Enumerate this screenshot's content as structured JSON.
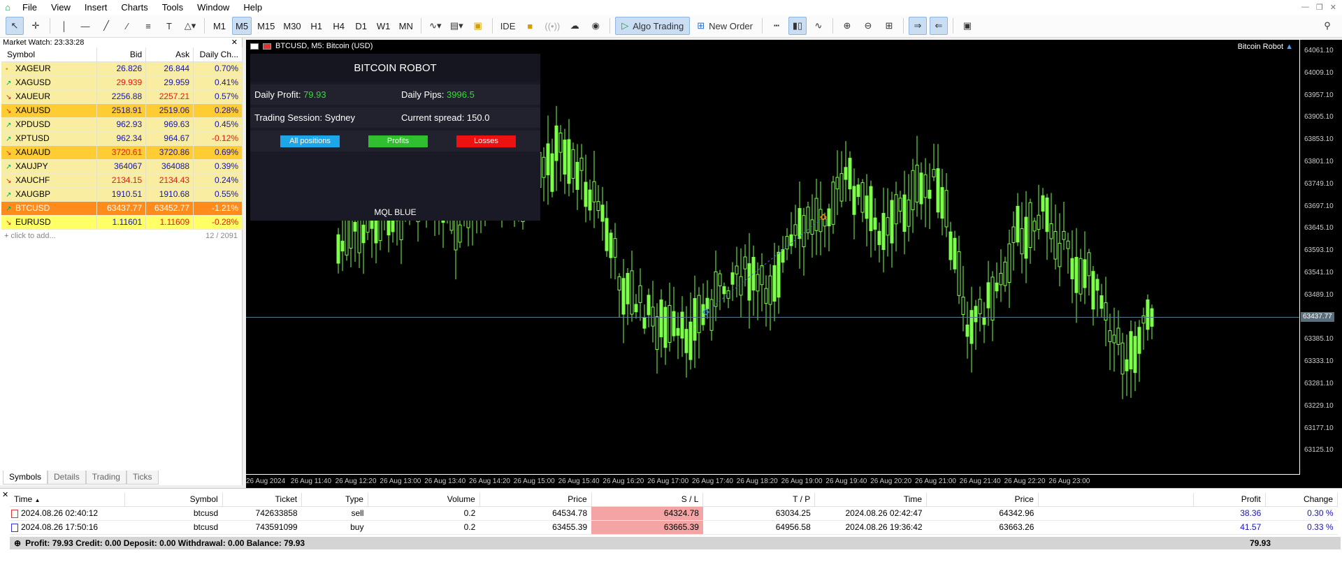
{
  "menu": {
    "items": [
      "File",
      "View",
      "Insert",
      "Charts",
      "Tools",
      "Window",
      "Help"
    ]
  },
  "toolbar": {
    "timeframes": [
      "M1",
      "M5",
      "M15",
      "M30",
      "H1",
      "H4",
      "D1",
      "W1",
      "MN"
    ],
    "active_timeframe": "M5",
    "ide_label": "IDE",
    "algo_label": "Algo Trading",
    "new_order_label": "New Order"
  },
  "market_watch": {
    "title": "Market Watch: 23:33:28",
    "columns": [
      "Symbol",
      "Bid",
      "Ask",
      "Daily Ch..."
    ],
    "rows": [
      {
        "symbol": "XAGEUR",
        "bid": "26.826",
        "ask": "26.844",
        "change": "0.70%",
        "dir": "flat",
        "style": "y",
        "bidcol": "up",
        "askcol": "up",
        "chcol": "up"
      },
      {
        "symbol": "XAGUSD",
        "bid": "29.939",
        "ask": "29.959",
        "change": "0.41%",
        "dir": "up",
        "style": "y",
        "bidcol": "dn",
        "askcol": "up",
        "chcol": "up"
      },
      {
        "symbol": "XAUEUR",
        "bid": "2256.88",
        "ask": "2257.21",
        "change": "0.57%",
        "dir": "down",
        "style": "y",
        "bidcol": "up",
        "askcol": "dn",
        "chcol": "up"
      },
      {
        "symbol": "XAUUSD",
        "bid": "2518.91",
        "ask": "2519.06",
        "change": "0.28%",
        "dir": "down",
        "style": "o",
        "bidcol": "up",
        "askcol": "up",
        "chcol": "up"
      },
      {
        "symbol": "XPDUSD",
        "bid": "962.93",
        "ask": "969.63",
        "change": "0.45%",
        "dir": "up",
        "style": "y",
        "bidcol": "up",
        "askcol": "up",
        "chcol": "up"
      },
      {
        "symbol": "XPTUSD",
        "bid": "962.34",
        "ask": "964.67",
        "change": "-0.12%",
        "dir": "up",
        "style": "y",
        "bidcol": "up",
        "askcol": "up",
        "chcol": "dn"
      },
      {
        "symbol": "XAUAUD",
        "bid": "3720.61",
        "ask": "3720.86",
        "change": "0.69%",
        "dir": "down",
        "style": "o",
        "bidcol": "dn",
        "askcol": "up",
        "chcol": "up"
      },
      {
        "symbol": "XAUJPY",
        "bid": "364067",
        "ask": "364088",
        "change": "0.39%",
        "dir": "up",
        "style": "y",
        "bidcol": "up",
        "askcol": "up",
        "chcol": "up"
      },
      {
        "symbol": "XAUCHF",
        "bid": "2134.15",
        "ask": "2134.43",
        "change": "0.24%",
        "dir": "down",
        "style": "y",
        "bidcol": "dn",
        "askcol": "dn",
        "chcol": "up"
      },
      {
        "symbol": "XAUGBP",
        "bid": "1910.51",
        "ask": "1910.68",
        "change": "0.55%",
        "dir": "up",
        "style": "y",
        "bidcol": "up",
        "askcol": "up",
        "chcol": "up"
      },
      {
        "symbol": "BTCUSD",
        "bid": "63437.77",
        "ask": "63452.77",
        "change": "-1.21%",
        "dir": "up",
        "style": "oo",
        "bidcol": "wh",
        "askcol": "wh",
        "chcol": "wh"
      },
      {
        "symbol": "EURUSD",
        "bid": "1.11601",
        "ask": "1.11609",
        "change": "-0.28%",
        "dir": "down",
        "style": "ly",
        "bidcol": "up",
        "askcol": "dn",
        "chcol": "dn"
      }
    ],
    "add_label": "click to add...",
    "count": "12 / 2091",
    "tabs": [
      "Symbols",
      "Details",
      "Trading",
      "Ticks"
    ]
  },
  "chart": {
    "title": "BTCUSD, M5:  Bitcoin (USD)",
    "robot_label": "Bitcoin Robot",
    "price_ticks": [
      "64061.10",
      "64009.10",
      "63957.10",
      "63905.10",
      "63853.10",
      "63801.10",
      "63749.10",
      "63697.10",
      "63645.10",
      "63593.10",
      "63541.10",
      "63489.10",
      "63437.77",
      "63385.10",
      "63333.10",
      "63281.10",
      "63229.10",
      "63177.10",
      "63125.10"
    ],
    "current_price": "63437.77",
    "time_ticks": [
      "26 Aug 2024",
      "26 Aug 11:40",
      "26 Aug 12:20",
      "26 Aug 13:00",
      "26 Aug 13:40",
      "26 Aug 14:20",
      "26 Aug 15:00",
      "26 Aug 15:40",
      "26 Aug 16:20",
      "26 Aug 17:00",
      "26 Aug 17:40",
      "26 Aug 18:20",
      "26 Aug 19:00",
      "26 Aug 19:40",
      "26 Aug 20:20",
      "26 Aug 21:00",
      "26 Aug 21:40",
      "26 Aug 22:20",
      "26 Aug 23:00"
    ]
  },
  "robot_panel": {
    "header": "BITCOIN ROBOT",
    "daily_profit_label": "Daily Profit: ",
    "daily_profit_value": "79.93",
    "daily_pips_label": "Daily Pips: ",
    "daily_pips_value": "3996.5",
    "session_label": "Trading Session: Sydney",
    "spread_label": "Current spread: 150.0",
    "btn_all": "All positions",
    "btn_profits": "Profits",
    "btn_losses": "Losses",
    "footer": "MQL BLUE",
    "colors": {
      "all": "#1ea7e8",
      "profits": "#2fbf2f",
      "losses": "#ee1111"
    }
  },
  "terminal": {
    "columns": [
      "Time",
      "Symbol",
      "Ticket",
      "Type",
      "Volume",
      "Price",
      "S / L",
      "T / P",
      "Time",
      "Price",
      "",
      "Profit",
      "Change"
    ],
    "rows": [
      {
        "time": "2024.08.26 02:40:12",
        "symbol": "btcusd",
        "ticket": "742633858",
        "type": "sell",
        "volume": "0.2",
        "price": "64534.78",
        "sl": "64324.78",
        "tp": "63034.25",
        "ctime": "2024.08.26 02:42:47",
        "cprice": "64342.96",
        "profit": "38.36",
        "change": "0.30 %"
      },
      {
        "time": "2024.08.26 17:50:16",
        "symbol": "btcusd",
        "ticket": "743591099",
        "type": "buy",
        "volume": "0.2",
        "price": "63455.39",
        "sl": "63665.39",
        "tp": "64956.58",
        "ctime": "2024.08.26 19:36:42",
        "cprice": "63663.26",
        "profit": "41.57",
        "change": "0.33 %"
      }
    ],
    "summary": "Profit: 79.93  Credit: 0.00  Deposit: 0.00  Withdrawal: 0.00  Balance: 79.93",
    "summary_profit": "79.93"
  }
}
